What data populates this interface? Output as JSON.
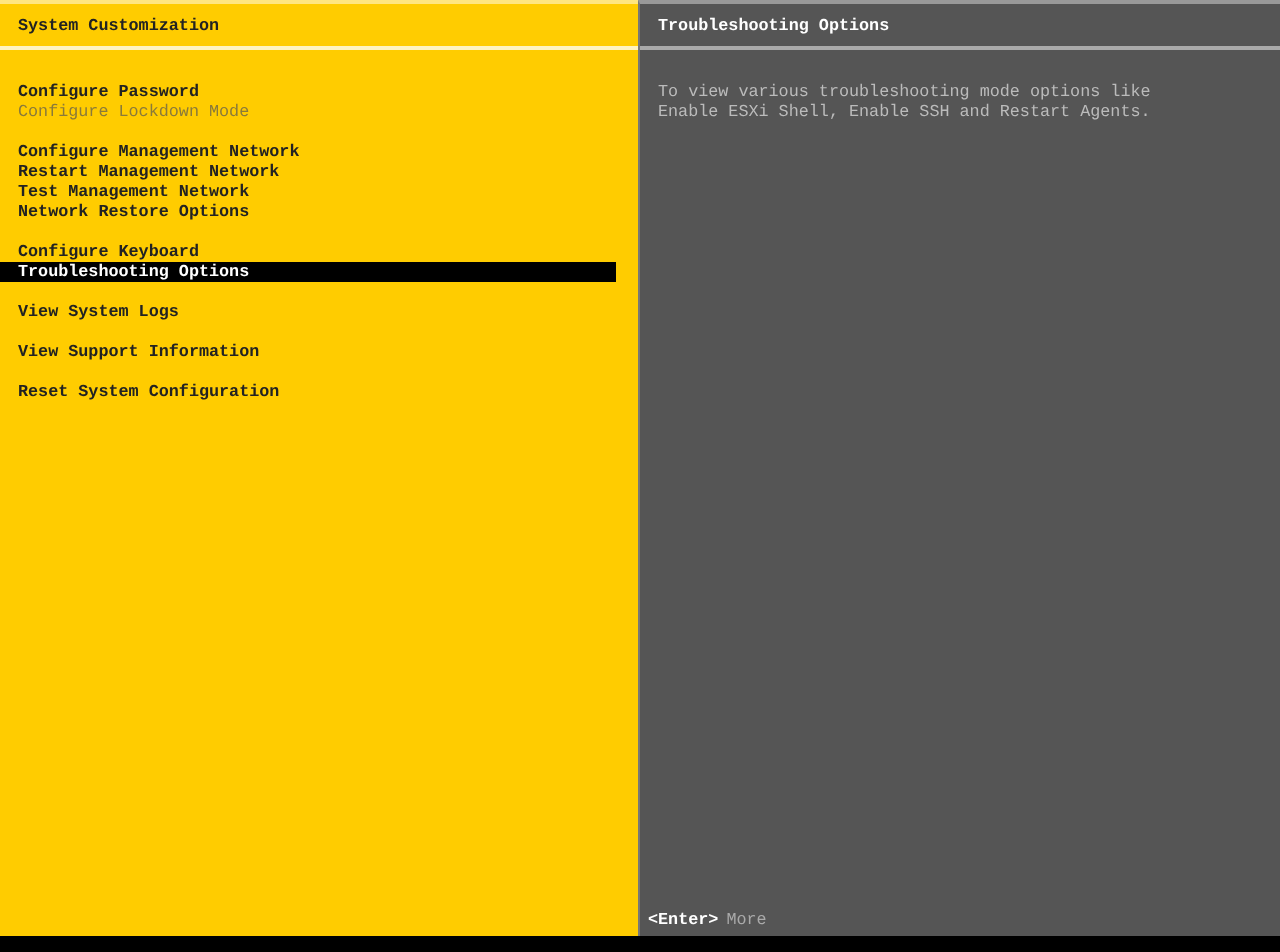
{
  "left_panel": {
    "title": "System Customization",
    "menu_groups": [
      [
        {
          "label": "Configure Password",
          "selected": false,
          "disabled": false
        },
        {
          "label": "Configure Lockdown Mode",
          "selected": false,
          "disabled": true
        }
      ],
      [
        {
          "label": "Configure Management Network",
          "selected": false,
          "disabled": false
        },
        {
          "label": "Restart Management Network",
          "selected": false,
          "disabled": false
        },
        {
          "label": "Test Management Network",
          "selected": false,
          "disabled": false
        },
        {
          "label": "Network Restore Options",
          "selected": false,
          "disabled": false
        }
      ],
      [
        {
          "label": "Configure Keyboard",
          "selected": false,
          "disabled": false
        },
        {
          "label": "Troubleshooting Options",
          "selected": true,
          "disabled": false
        }
      ],
      [
        {
          "label": "View System Logs",
          "selected": false,
          "disabled": false
        }
      ],
      [
        {
          "label": "View Support Information",
          "selected": false,
          "disabled": false
        }
      ],
      [
        {
          "label": "Reset System Configuration",
          "selected": false,
          "disabled": false
        }
      ]
    ]
  },
  "right_panel": {
    "title": "Troubleshooting Options",
    "description": "To view various troubleshooting mode options like Enable ESXi Shell, Enable SSH and Restart Agents.",
    "footer": {
      "key": "<Enter>",
      "action": "More"
    }
  }
}
